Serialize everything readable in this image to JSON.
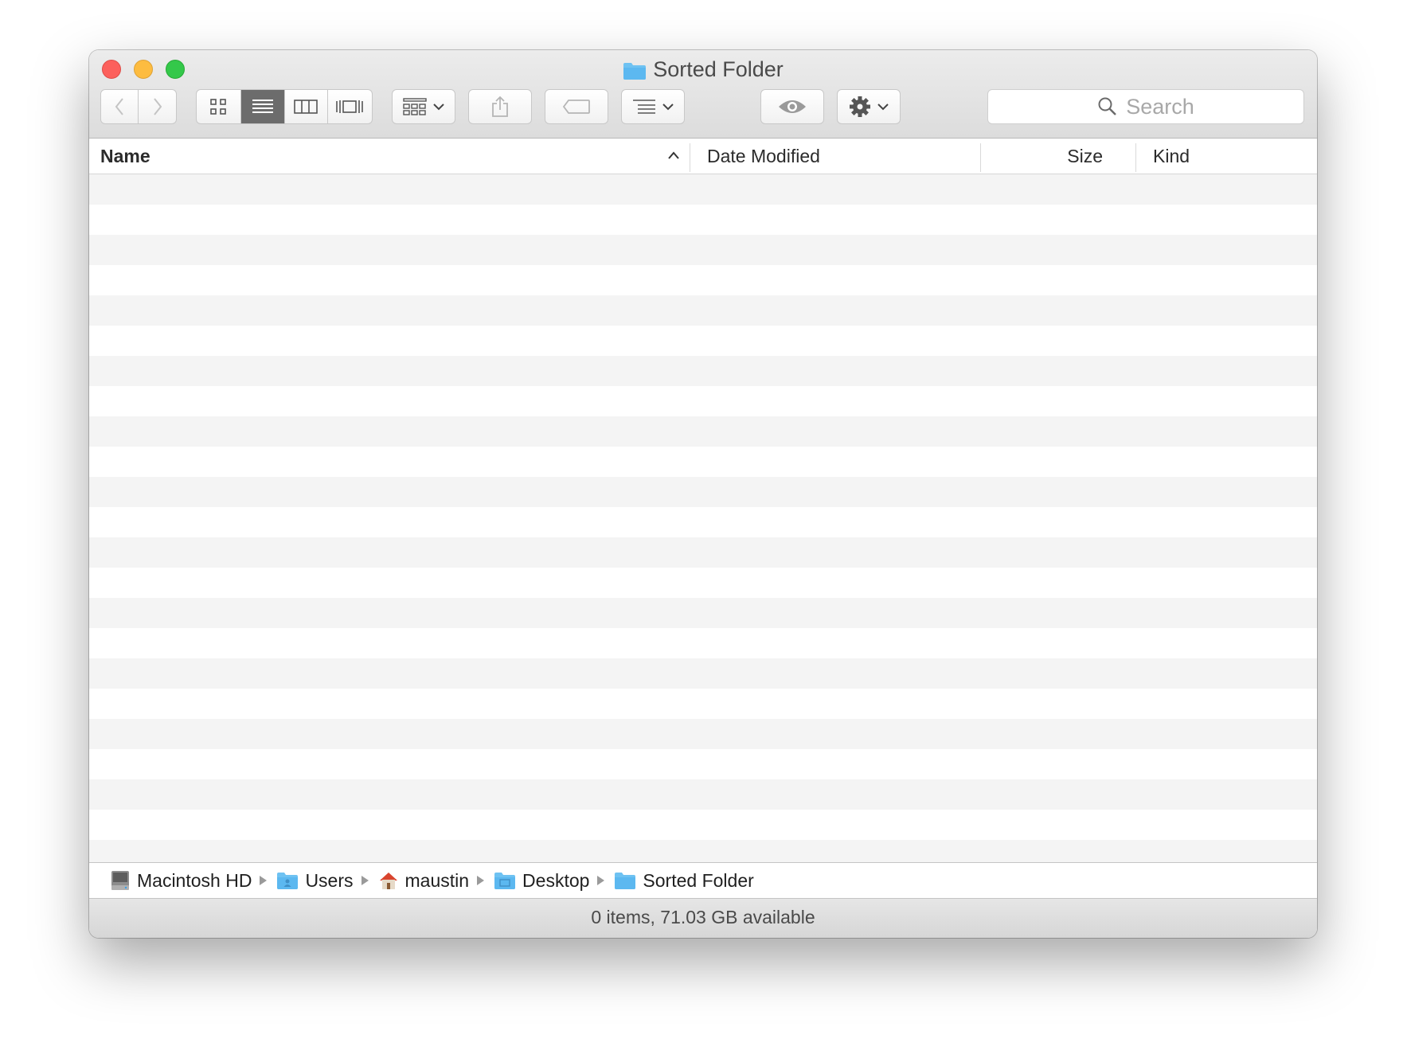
{
  "window": {
    "title": "Sorted Folder"
  },
  "toolbar": {
    "back_icon": "chevron-left-icon",
    "forward_icon": "chevron-right-icon",
    "view_modes": [
      "icon-view",
      "list-view",
      "column-view",
      "cover-flow-view"
    ],
    "active_view": "list-view",
    "search_placeholder": "Search"
  },
  "columns": {
    "name": "Name",
    "date_modified": "Date Modified",
    "size": "Size",
    "kind": "Kind",
    "sort_column": "Name",
    "sort_direction": "ascending"
  },
  "rows": [],
  "pathbar": {
    "items": [
      {
        "label": "Macintosh HD",
        "icon": "hard-drive-icon"
      },
      {
        "label": "Users",
        "icon": "users-folder-icon"
      },
      {
        "label": "maustin",
        "icon": "home-icon"
      },
      {
        "label": "Desktop",
        "icon": "desktop-folder-icon"
      },
      {
        "label": "Sorted Folder",
        "icon": "folder-icon"
      }
    ]
  },
  "status": {
    "text": "0 items, 71.03 GB available"
  },
  "colors": {
    "folder_blue": "#5cb8f0",
    "close": "#fc605c",
    "minimize": "#fdbc40",
    "maximize": "#34c84a",
    "active_segment": "#6c6c6c"
  }
}
